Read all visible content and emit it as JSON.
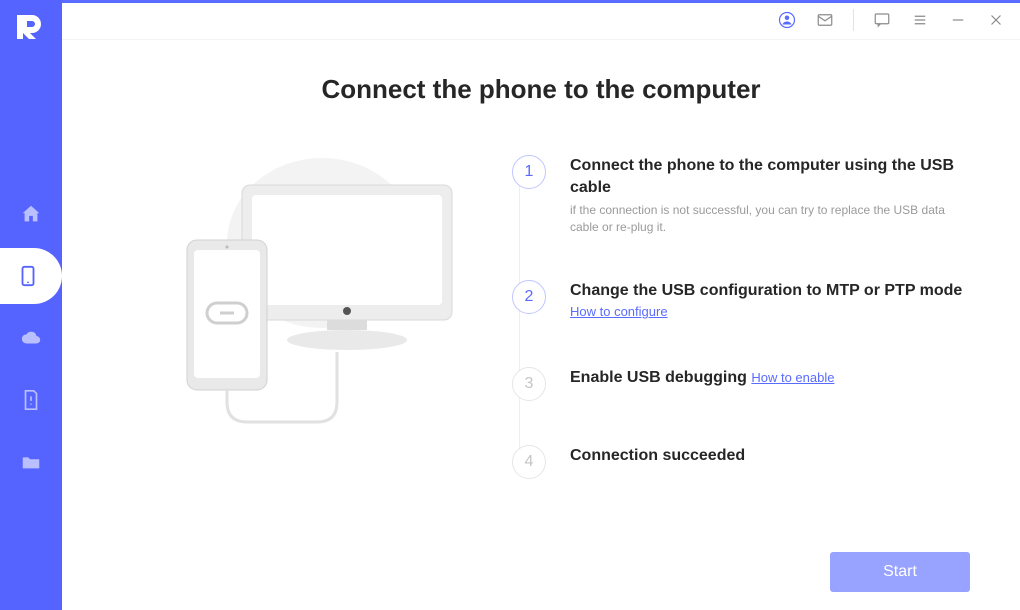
{
  "page": {
    "title": "Connect the phone to the computer"
  },
  "steps": [
    {
      "num": "1",
      "title": "Connect the phone to the computer using the USB cable",
      "desc": "if the connection is not successful, you can try to replace the USB data cable or re-plug it."
    },
    {
      "num": "2",
      "title": "Change the USB configuration to MTP or PTP mode",
      "link": "How to configure"
    },
    {
      "num": "3",
      "title": "Enable USB debugging",
      "link": "How to enable"
    },
    {
      "num": "4",
      "title": "Connection succeeded"
    }
  ],
  "buttons": {
    "start": "Start"
  }
}
